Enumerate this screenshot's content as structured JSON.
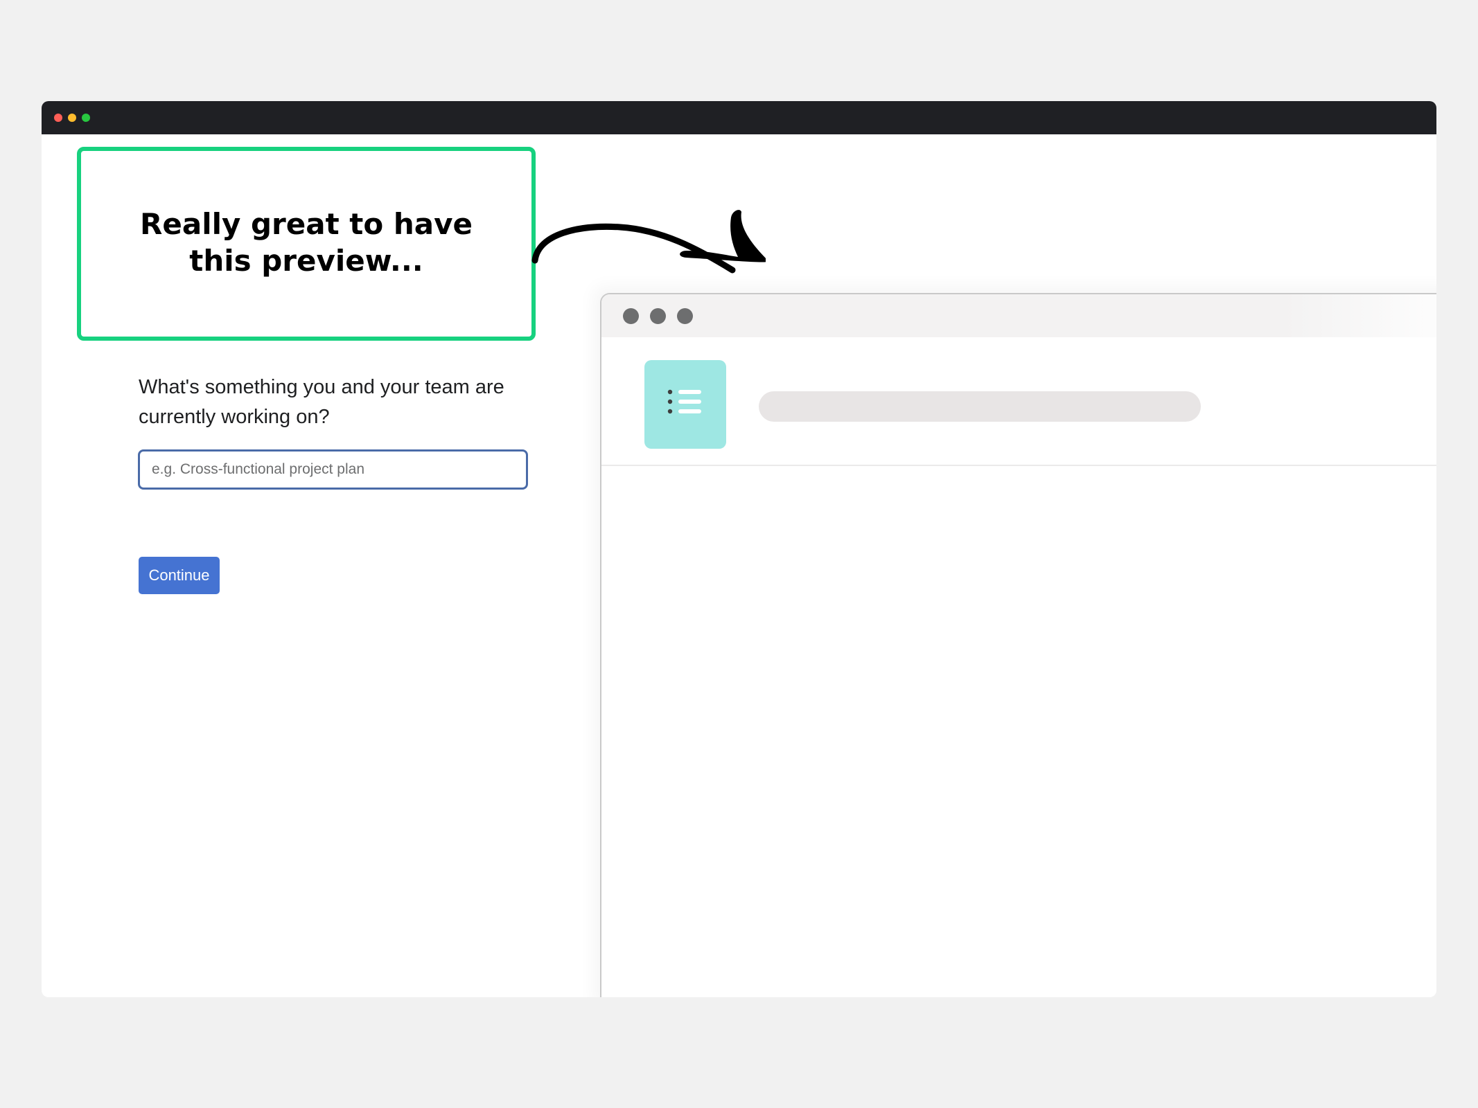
{
  "callout": {
    "text": "Really great to have this preview...",
    "border_color": "#17d17f"
  },
  "form": {
    "question": "What's something you and your team are currently working on?",
    "input_value": "",
    "input_placeholder": "e.g. Cross-functional project plan",
    "continue_label": "Continue",
    "button_color": "#4573d2"
  },
  "browser": {
    "titlebar_color": "#1f2024",
    "window_dots": [
      "#ff5f57",
      "#febc2e",
      "#28c840"
    ]
  },
  "preview": {
    "window_dots_color": "#6d6e6f",
    "project_icon": "list-icon",
    "project_tile_color": "#9ee7e3"
  },
  "annotation": {
    "arrow_icon": "curved-arrow-icon"
  }
}
